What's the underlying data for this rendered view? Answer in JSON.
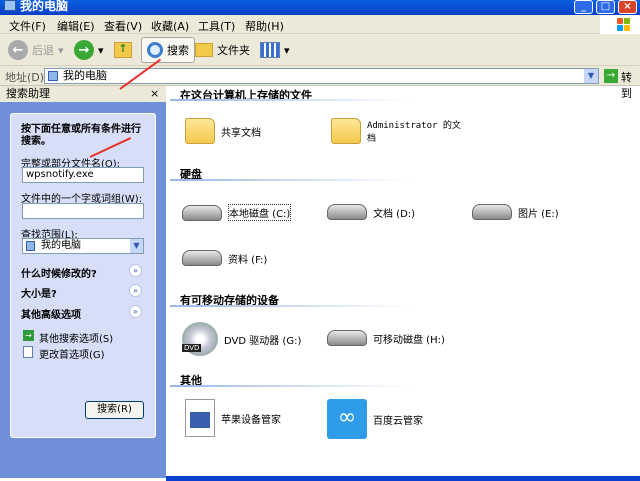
{
  "window": {
    "title": "我的电脑"
  },
  "menu": [
    "文件(F)",
    "编辑(E)",
    "查看(V)",
    "收藏(A)",
    "工具(T)",
    "帮助(H)"
  ],
  "toolbar": {
    "back": "后退",
    "search": "搜索",
    "folders": "文件夹"
  },
  "address": {
    "label": "地址(D)",
    "value": "我的电脑",
    "go": "转到"
  },
  "search_pane": {
    "title": "搜索助理",
    "close": "×",
    "prompt": "按下面任意或所有条件进行搜索。",
    "name_label": "完整或部分文件名(O):",
    "name_value": "wpsnotify.exe",
    "word_label": "文件中的一个字或词组(W):",
    "word_value": "",
    "scope_label": "查找范围(L):",
    "scope_value": "我的电脑",
    "when_modified": "什么时候修改的?",
    "size": "大小是?",
    "advanced": "其他高级选项",
    "other_search": "其他搜索选项(S)",
    "change_prefs": "更改首选项(G)",
    "search_button": "搜索(R)"
  },
  "sections": {
    "stored": {
      "title": "在这台计算机上存储的文件",
      "items": [
        "共享文档",
        "Administrator 的文档"
      ]
    },
    "hdd": {
      "title": "硬盘",
      "items": [
        "本地磁盘 (C:)",
        "文档 (D:)",
        "图片 (E:)",
        "资料 (F:)"
      ]
    },
    "removable": {
      "title": "有可移动存储的设备",
      "items": [
        "DVD 驱动器 (G:)",
        "可移动磁盘 (H:)"
      ]
    },
    "other": {
      "title": "其他",
      "items": [
        "苹果设备管家",
        "百度云管家"
      ]
    }
  },
  "colors": {
    "title_blue": "#0a5fe0",
    "pane_blue": "#6f8fd8",
    "annotation_red": "#e8302a"
  }
}
